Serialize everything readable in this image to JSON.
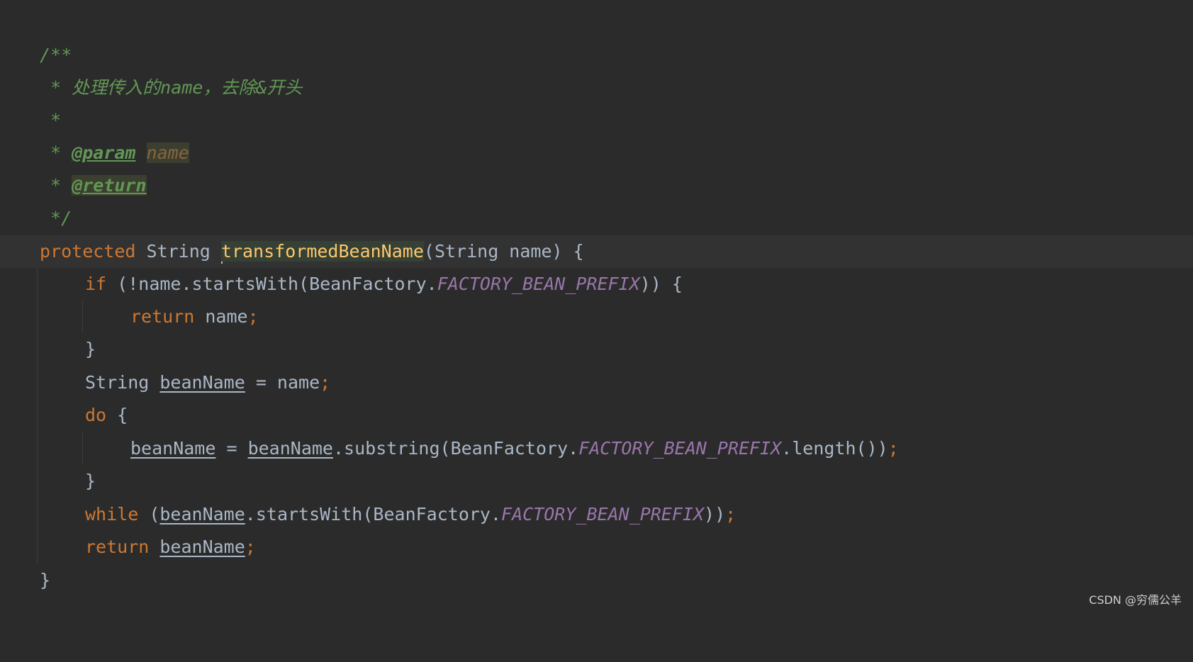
{
  "editor": {
    "background": "#2b2b2b",
    "current_line_background": "#323232",
    "colors": {
      "doc_comment": "#629755",
      "keyword": "#cc7832",
      "plain": "#a9b7c6",
      "method_declaration": "#ffc66d",
      "static_constant": "#9876aa",
      "param_reference": "#8a653b"
    },
    "doc": {
      "open": "/**",
      "star": " *",
      "desc": " 处理传入的name，去除&开头",
      "param_tag": "@param",
      "param_name": "name",
      "return_tag": "@return",
      "close": " */"
    },
    "sig": {
      "modifier": "protected",
      "return_type": "String",
      "method_name": "transformedBeanName",
      "params_open": "(String name) {"
    },
    "code": {
      "if_kw": "if",
      "if_cond_1": " (!name.startsWith(BeanFactory.",
      "prefix_const": "FACTORY_BEAN_PREFIX",
      "if_cond_2": ")) {",
      "return_kw": "return",
      "return_name": " name",
      "semicolon": ";",
      "close_brace": "}",
      "string_type": "String ",
      "bean_name": "beanName",
      "assign_name": " = name",
      "do_kw": "do",
      "do_open": " {",
      "assign_eq": " = ",
      "substring_call": ".substring(BeanFactory.",
      "length_call": ".length())",
      "while_kw": "while",
      "while_open": " (",
      "starts_with": ".startsWith(BeanFactory.",
      "while_close": "))",
      "return_space": " ",
      "final_brace": "}"
    }
  },
  "watermark": {
    "text": "CSDN @穷儒公羊"
  }
}
